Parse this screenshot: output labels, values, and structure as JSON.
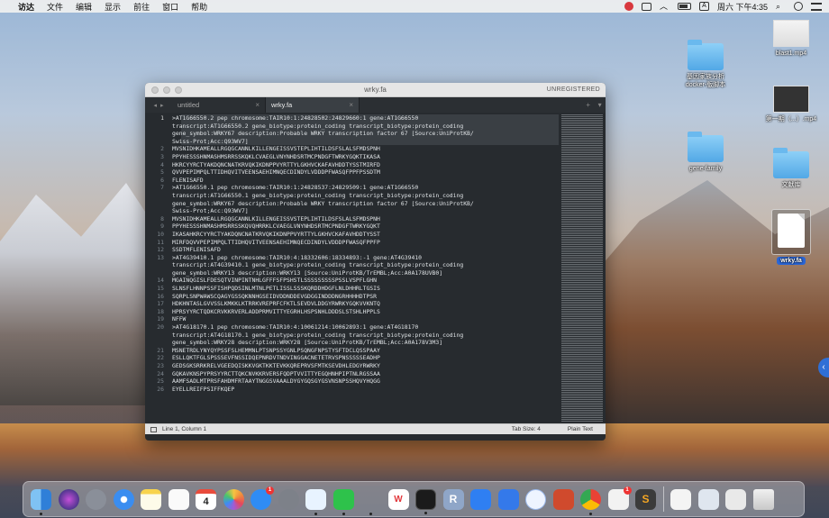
{
  "menubar": {
    "app_name": "访达",
    "items": [
      "文件",
      "编辑",
      "显示",
      "前往",
      "窗口",
      "帮助"
    ],
    "input_method": "A",
    "clock": "周六 下午4:35"
  },
  "desktop": {
    "items": [
      {
        "label": "blast1.mp4"
      },
      {
        "label": "基因家族分析\ndocker-版脚本"
      },
      {
        "label": "第一期（...）.mp4"
      },
      {
        "label": "gene-family"
      },
      {
        "label": "文献库"
      },
      {
        "label": "wrky.fa"
      }
    ]
  },
  "window": {
    "title": "wrky.fa",
    "unregistered": "UNREGISTERED",
    "tabs": [
      {
        "label": "untitled",
        "close": "×"
      },
      {
        "label": "wrky.fa",
        "close": "×"
      }
    ],
    "tab_controls": [
      "+",
      "▾"
    ],
    "lines": [
      {
        "n": "1",
        "text": ">AT1G66550.2 pep chromosome:TAIR10:1:24828502:24829660:1 gene:AT1G66550"
      },
      {
        "n": "",
        "text": "transcript:AT1G66550.2 gene_biotype:protein_coding transcript_biotype:protein_coding"
      },
      {
        "n": "",
        "text": "gene_symbol:WRKY67 description:Probable WRKY transcription factor 67 [Source:UniProtKB/"
      },
      {
        "n": "",
        "text": "Swiss-Prot;Acc:Q93WV7]"
      },
      {
        "n": "2",
        "text": "MVSNIDHKAMEALLRGQGCANNLKILLENGEISSVSTEPLIHTILDSFSLALSFMDSPNH"
      },
      {
        "n": "3",
        "text": "PPYHESSSHNMASHMSRRSSKQKLCVAEGLVNYNHDSRTMCPNDGFTWRKYGQKTIKASA"
      },
      {
        "n": "4",
        "text": "HKRCYYRCTYAKDQNCNATKRVQKIKDNPPVYRTTYLGKHVCKAFAVHDDTYSSTMIRFD"
      },
      {
        "n": "5",
        "text": "QVVPEPIMPQLTTIDHQVITVEENSAEHIMNQECDINDYLVDDDPFWASQFPPFPSSDTM"
      },
      {
        "n": "6",
        "text": "FLENISAFD"
      },
      {
        "n": "7",
        "text": ">AT1G66550.1 pep chromosome:TAIR10:1:24828537:24829509:1 gene:AT1G66550"
      },
      {
        "n": "",
        "text": "transcript:AT1G66550.1 gene_biotype:protein_coding transcript_biotype:protein_coding"
      },
      {
        "n": "",
        "text": "gene_symbol:WRKY67 description:Probable WRKY transcription factor 67 [Source:UniProtKB/"
      },
      {
        "n": "",
        "text": "Swiss-Prot;Acc:Q93WV7]"
      },
      {
        "n": "8",
        "text": "MVSNIDHKAMEALLRGQGCANNLKILLENGEISSVSTEPLIHTILDSFSLALSFMDSPNH"
      },
      {
        "n": "9",
        "text": "PPYHESSSHNMASHMSRRSSKQVQHRRKLCVAEGLVNYNHDSRTMCPNDGFTWRKYGQKT"
      },
      {
        "n": "10",
        "text": "IKASAHKRCYYRCTYAKDQNCNATKRVQKIKDNPPVYRTTYLGKHVCKAFAVHDDTYSST"
      },
      {
        "n": "11",
        "text": "MIRFDQVVPEPIMPQLTTIDHQVITVEENSAEHIMNQECDINDYLVDDDPFWASQFPPFP"
      },
      {
        "n": "12",
        "text": "SSDTMFLENISAFD"
      },
      {
        "n": "13",
        "text": ">AT4G39410.1 pep chromosome:TAIR10:4:18332606:18334893:-1 gene:AT4G39410"
      },
      {
        "n": "",
        "text": "transcript:AT4G39410.1 gene_biotype:protein_coding transcript_biotype:protein_coding"
      },
      {
        "n": "",
        "text": "gene_symbol:WRKY13 description:WRKY13 [Source:UniProtKB/TrEMBL;Acc:A0A178UVB0]"
      },
      {
        "n": "14",
        "text": "MGAINQGISLFDESQTVINPINTNHLGFFFSFPSHSTLSSSSSSSSSPSSLVSPFLGHN"
      },
      {
        "n": "15",
        "text": "SLNSFLHNNPSSFISHPQDSINLMTNLPETLISSLSSSKQRDDHDGFLNLDHHRLTGSIS"
      },
      {
        "n": "16",
        "text": "SQRPLSNPWAWSCQAGYGSSQKNNHGSEIDVDDNDDEVGDGGINDDDNGRHHHHDTPSR"
      },
      {
        "n": "17",
        "text": "HDKHNTASLGVVSSLKMKKLKTRRKVREPRFCFKTLSEVDVLDDGYRWRKYGQKVVKNTQ"
      },
      {
        "n": "18",
        "text": "HPRSYYRCTQDKCRVKKRVERLADDPRMVITTYEGRHLHSPSNHLDDDSLSTSHLHPPLS"
      },
      {
        "n": "19",
        "text": "NFFW"
      },
      {
        "n": "20",
        "text": ">AT4G18170.1 pep chromosome:TAIR10:4:10061214:10062893:1 gene:AT4G18170"
      },
      {
        "n": "",
        "text": "transcript:AT4G18170.1 gene_biotype:protein_coding transcript_biotype:protein_coding"
      },
      {
        "n": "",
        "text": "gene_symbol:WRKY28 description:WRKY28 [Source:UniProtKB/TrEMBL;Acc:A0A178V3M3]"
      },
      {
        "n": "21",
        "text": "MSNETRDLYNYQYPSSFSLHEMMNLPTSNPSSYGNLPSQNGFNPSTYSFTDCLQSSPAAY"
      },
      {
        "n": "22",
        "text": "ESLLQKTFGLSPSSSEVFNSSIDQEPNRDVTNDVINGGACNETETRVSPNSSSSSEADHP"
      },
      {
        "n": "23",
        "text": "GEDSGKSRRKRELVGEEDQISKKVGKTKKTEVKKQREPRVSFMTKSEVDHLEDGYRWRKY"
      },
      {
        "n": "24",
        "text": "GQKAVKNSPYPRSYYRCTTQKCNVKKRVERSFQDPTVVITTYEGQHNHPIPTNLRGSSAA"
      },
      {
        "n": "25",
        "text": "AAMFSADLMTPRSFAHDMFRTAAYTNGGSVAAALDYGYGQSGYGSVNSNPSSHQVYHQGG"
      },
      {
        "n": "26",
        "text": "EYELLREIFPSIFFKQEP"
      }
    ],
    "status": {
      "position": "Line 1, Column 1",
      "tab_size": "Tab Size: 4",
      "syntax": "Plain Text"
    }
  },
  "dock": {
    "calendar_day": "4",
    "badges": {
      "app_store": "1",
      "wps": "1"
    },
    "r_letter": "R",
    "wps_letter": "W",
    "sublime_letter": "S"
  }
}
